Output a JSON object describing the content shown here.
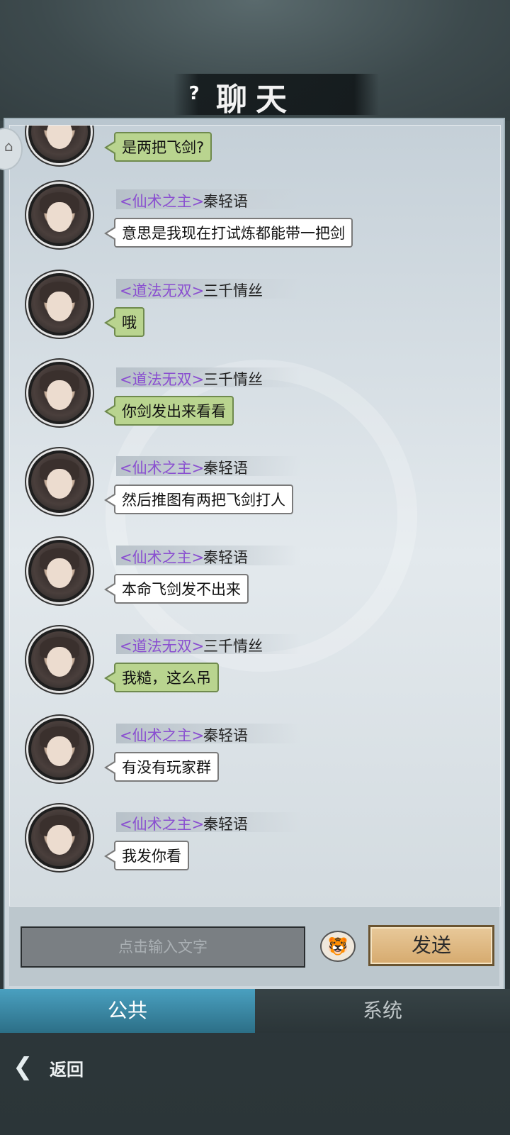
{
  "header": {
    "title": "聊天",
    "help_icon": "question-icon",
    "help_text": "?"
  },
  "messages": [
    {
      "title_tag": "",
      "name": "",
      "text": "是两把飞剑?",
      "color": "green"
    },
    {
      "title_tag": "<仙术之主>",
      "name": "秦轻语",
      "text": "意思是我现在打试炼都能带一把剑",
      "color": "white"
    },
    {
      "title_tag": "<道法无双>",
      "name": "三千情丝",
      "text": "哦",
      "color": "green"
    },
    {
      "title_tag": "<道法无双>",
      "name": "三千情丝",
      "text": "你剑发出来看看",
      "color": "green"
    },
    {
      "title_tag": "<仙术之主>",
      "name": "秦轻语",
      "text": "然后推图有两把飞剑打人",
      "color": "white"
    },
    {
      "title_tag": "<仙术之主>",
      "name": "秦轻语",
      "text": "本命飞剑发不出来",
      "color": "white"
    },
    {
      "title_tag": "<道法无双>",
      "name": "三千情丝",
      "text": "我糙，这么吊",
      "color": "green"
    },
    {
      "title_tag": "<仙术之主>",
      "name": "秦轻语",
      "text": "有没有玩家群",
      "color": "white"
    },
    {
      "title_tag": "<仙术之主>",
      "name": "秦轻语",
      "text": "我发你看",
      "color": "white"
    }
  ],
  "input": {
    "placeholder": "点击输入文字",
    "emoji_icon": "tiger-emoji-icon",
    "send_label": "发送"
  },
  "tabs": {
    "public": "公共",
    "system": "系统"
  },
  "footer": {
    "back_label": "返回",
    "back_icon": "back-arrow-icon"
  },
  "colors": {
    "title_tag": "#8a4fd0",
    "green_bubble": "#b9d48f",
    "white_bubble": "#ffffff",
    "active_tab": "#3a8aa8"
  }
}
